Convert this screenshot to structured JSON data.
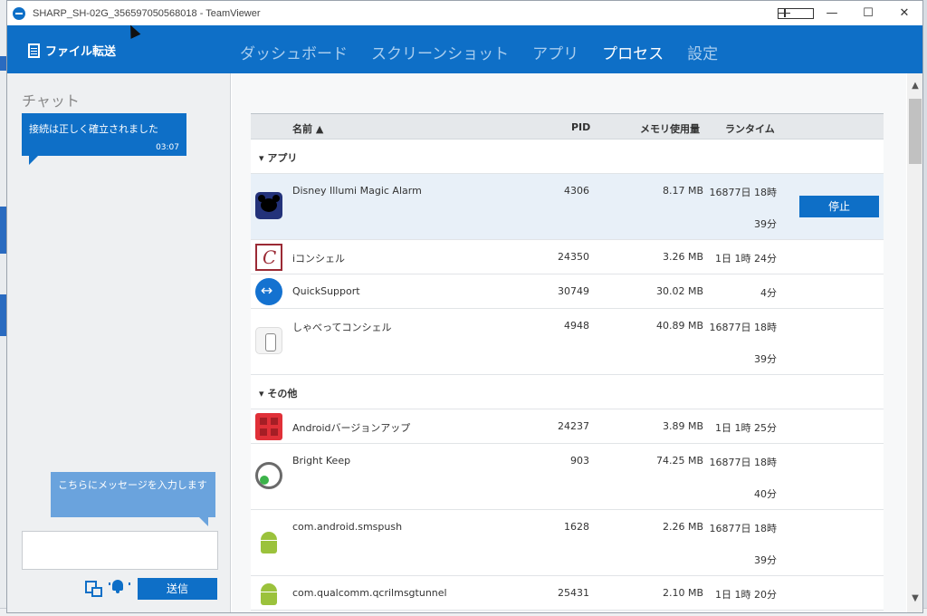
{
  "window": {
    "title": "SHARP_SH-02G_356597050568018 - TeamViewer",
    "controls": {
      "minimize": "—",
      "maximize": "☐",
      "close": "✕"
    }
  },
  "nav": {
    "file_transfer": "ファイル転送",
    "tabs": [
      "ダッシュボード",
      "スクリーンショット",
      "アプリ",
      "プロセス",
      "設定"
    ],
    "active_tab": "プロセス"
  },
  "chat": {
    "title": "チャット",
    "system_message": "接続は正しく確立されました",
    "system_time": "03:07",
    "hint": "こちらにメッセージを入力します",
    "send_label": "送信"
  },
  "table": {
    "headers": {
      "name": "名前 ▲",
      "pid": "PID",
      "memory": "メモリ使用量",
      "runtime": "ランタイム"
    },
    "groups": [
      {
        "label": "▾ アプリ",
        "rows": [
          {
            "name": "Disney Illumi Magic Alarm",
            "pid": "4306",
            "memory": "8.17 MB",
            "runtime1": "16877日 18時",
            "runtime2": "39分",
            "icon": "mickey-icon",
            "action": "停止"
          },
          {
            "name": "iコンシェル",
            "pid": "24350",
            "memory": "3.26 MB",
            "runtime1": "1日 1時 24分",
            "icon": "concier-icon"
          },
          {
            "name": "QuickSupport",
            "pid": "30749",
            "memory": "30.02 MB",
            "runtime1": "4分",
            "icon": "quicksupport-icon"
          },
          {
            "name": "しゃべってコンシェル",
            "pid": "4948",
            "memory": "40.89 MB",
            "runtime1": "16877日 18時",
            "runtime2": "39分",
            "icon": "shabette-icon"
          }
        ]
      },
      {
        "label": "▾ その他",
        "rows": [
          {
            "name": "Androidバージョンアップ",
            "pid": "24237",
            "memory": "3.89 MB",
            "runtime1": "1日 1時 25分",
            "icon": "update-icon"
          },
          {
            "name": "Bright Keep",
            "pid": "903",
            "memory": "74.25 MB",
            "runtime1": "16877日 18時",
            "runtime2": "40分",
            "icon": "brightkeep-icon"
          },
          {
            "name": "com.android.smspush",
            "pid": "1628",
            "memory": "2.26 MB",
            "runtime1": "16877日 18時",
            "runtime2": "39分",
            "icon": "android-icon"
          },
          {
            "name": "com.qualcomm.qcrilmsgtunnel",
            "pid": "25431",
            "memory": "2.10 MB",
            "runtime1": "1日 1時 20分",
            "icon": "android-icon"
          }
        ]
      }
    ]
  },
  "colors": {
    "accent": "#0e6fc7",
    "hint_bubble": "#6aa3dd",
    "selected_row": "#e8f0f8"
  }
}
